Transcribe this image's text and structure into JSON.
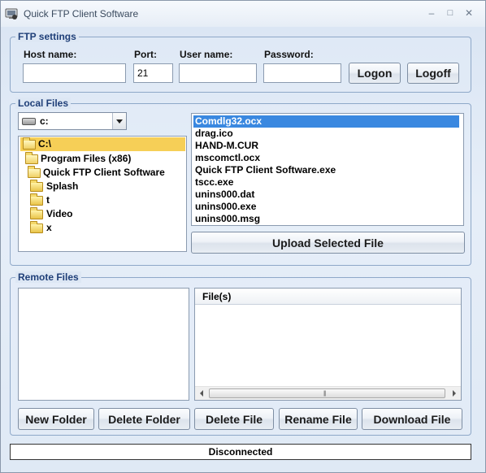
{
  "window": {
    "title": "Quick FTP Client Software",
    "minimize_glyph": "–",
    "maximize_glyph": "□",
    "close_glyph": "✕"
  },
  "ftp_settings": {
    "group_label": "FTP settings",
    "host_label": "Host name:",
    "host_value": "",
    "port_label": "Port:",
    "port_value": "21",
    "user_label": "User name:",
    "user_value": "",
    "password_label": "Password:",
    "password_value": "",
    "logon_button": "Logon",
    "logoff_button": "Logoff"
  },
  "local_files": {
    "group_label": "Local Files",
    "drive": "c:",
    "tree": [
      {
        "label": "C:\\",
        "selected": true
      },
      {
        "label": "Program Files (x86)"
      },
      {
        "label": "Quick FTP Client Software"
      },
      {
        "label": "Splash"
      },
      {
        "label": "t"
      },
      {
        "label": "Video"
      },
      {
        "label": "x"
      }
    ],
    "files": [
      {
        "name": "Comdlg32.ocx",
        "selected": true
      },
      {
        "name": "drag.ico"
      },
      {
        "name": "HAND-M.CUR"
      },
      {
        "name": "mscomctl.ocx"
      },
      {
        "name": "Quick FTP Client Software.exe"
      },
      {
        "name": "tscc.exe"
      },
      {
        "name": "unins000.dat"
      },
      {
        "name": "unins000.exe"
      },
      {
        "name": "unins000.msg"
      }
    ],
    "upload_button": "Upload Selected File"
  },
  "remote_files": {
    "group_label": "Remote Files",
    "column_header": "File(s)",
    "scroll_grip": "|||",
    "buttons": {
      "new_folder": "New Folder",
      "delete_folder": "Delete Folder",
      "delete_file": "Delete File",
      "rename_file": "Rename File",
      "download_file": "Download File"
    }
  },
  "status": {
    "text": "Disconnected"
  }
}
